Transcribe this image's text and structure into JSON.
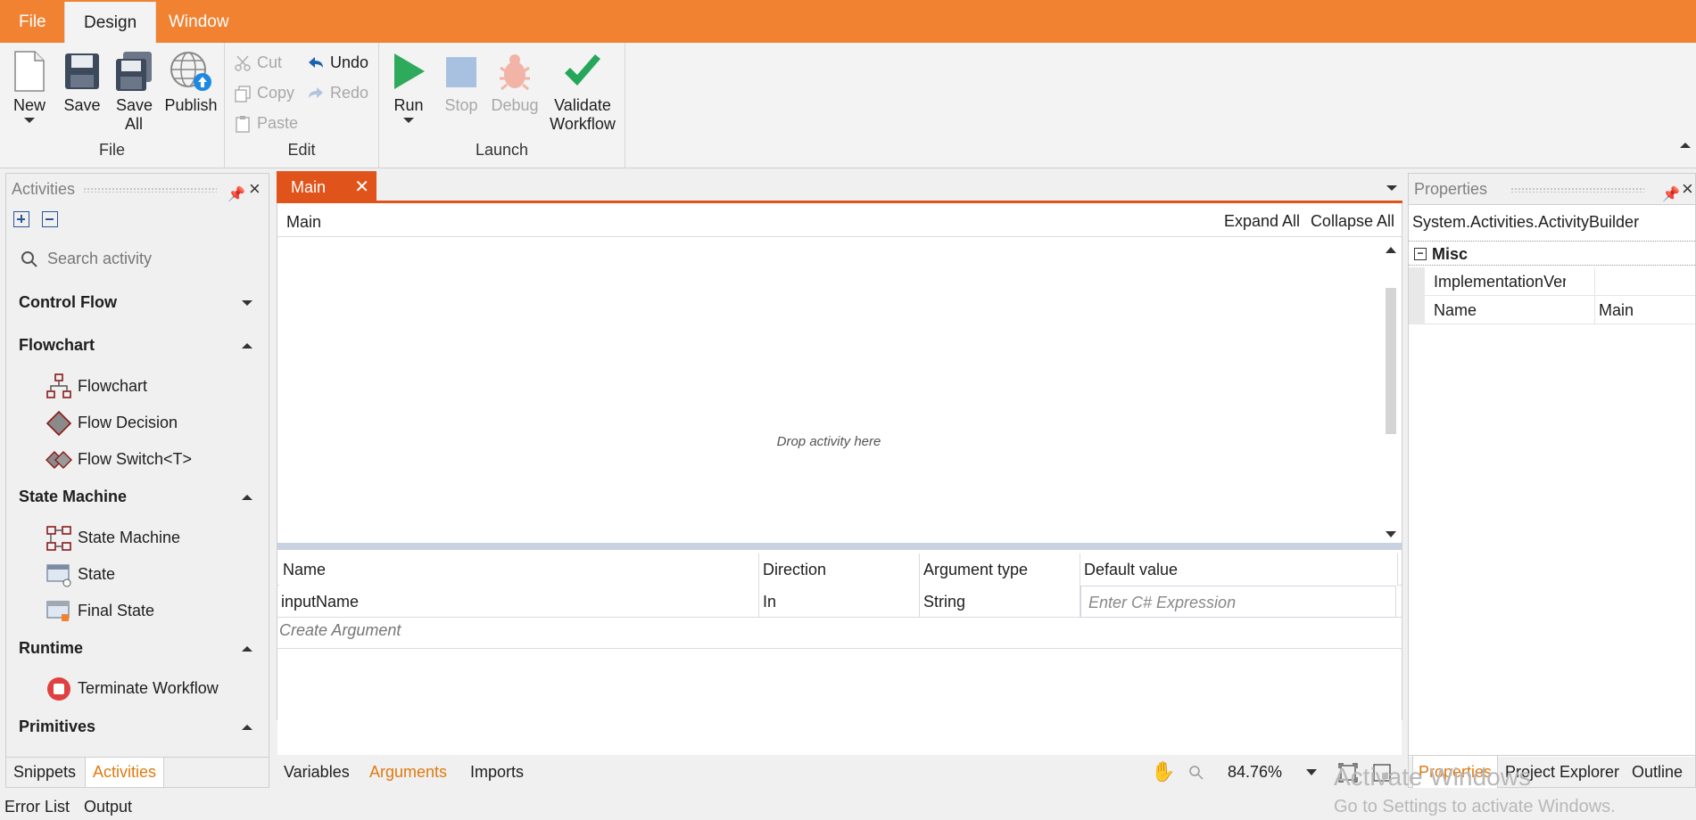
{
  "menu": {
    "items": [
      "File",
      "Design",
      "Window"
    ]
  },
  "ribbon": {
    "file_group": {
      "label": "File",
      "new": "New",
      "save": "Save",
      "save_all": "Save All",
      "publish": "Publish"
    },
    "edit_group": {
      "label": "Edit",
      "cut": "Cut",
      "copy": "Copy",
      "paste": "Paste",
      "undo": "Undo",
      "redo": "Redo"
    },
    "launch_group": {
      "label": "Launch",
      "run": "Run",
      "stop": "Stop",
      "debug": "Debug",
      "validate": "Validate Workflow"
    }
  },
  "activities_panel": {
    "title": "Activities",
    "search_placeholder": "Search activity",
    "categories": [
      {
        "name": "Control Flow",
        "expanded": false,
        "items": []
      },
      {
        "name": "Flowchart",
        "expanded": true,
        "items": [
          "Flowchart",
          "Flow Decision",
          "Flow Switch<T>"
        ]
      },
      {
        "name": "State Machine",
        "expanded": true,
        "items": [
          "State Machine",
          "State",
          "Final State"
        ]
      },
      {
        "name": "Runtime",
        "expanded": true,
        "items": [
          "Terminate Workflow"
        ]
      },
      {
        "name": "Primitives",
        "expanded": true,
        "items": []
      }
    ],
    "tabs": [
      "Snippets",
      "Activities"
    ]
  },
  "document": {
    "tab": "Main",
    "breadcrumb": "Main",
    "expand_all": "Expand All",
    "collapse_all": "Collapse All",
    "drop_hint": "Drop activity here"
  },
  "arguments": {
    "columns": [
      "Name",
      "Direction",
      "Argument type",
      "Default value"
    ],
    "rows": [
      {
        "name": "inputName",
        "direction": "In",
        "type": "String",
        "default_placeholder": "Enter C# Expression"
      }
    ],
    "create": "Create Argument"
  },
  "bottom_tabs": [
    "Variables",
    "Arguments",
    "Imports"
  ],
  "zoom": "84.76%",
  "properties_panel": {
    "title": "Properties",
    "object": "System.Activities.ActivityBuilder",
    "category": "Misc",
    "rows": [
      {
        "key": "ImplementationVer...",
        "value": ""
      },
      {
        "key": "Name",
        "value": "Main"
      }
    ],
    "tabs": [
      "Properties",
      "Project Explorer",
      "Outline"
    ]
  },
  "status": {
    "items": [
      "Error List",
      "Output"
    ]
  },
  "watermark": {
    "line1": "Activate Windows",
    "line2": "Go to Settings to activate Windows."
  },
  "colors": {
    "accent": "#f08232",
    "doc_tab": "#e0541b",
    "active_tab_text": "#e07a10"
  }
}
